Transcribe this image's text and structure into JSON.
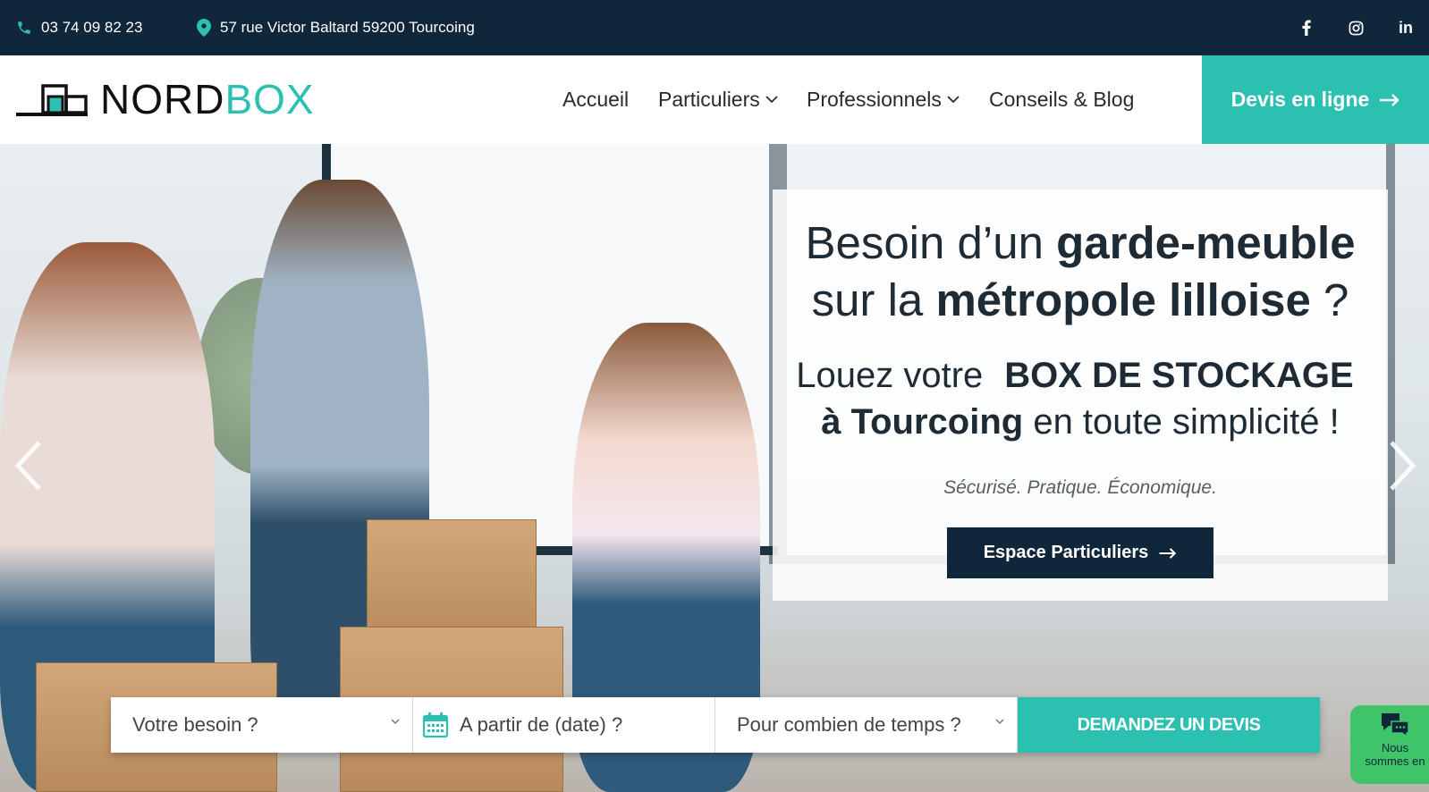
{
  "topbar": {
    "phone": "03 74 09 82 23",
    "address": "57 rue Victor Baltard 59200 Tourcoing",
    "social": [
      "facebook-icon",
      "instagram-icon",
      "linkedin-icon"
    ],
    "linkedin_label": "in"
  },
  "header": {
    "logo_part1": "NORD",
    "logo_part2": "BOX",
    "nav": {
      "accueil": "Accueil",
      "particuliers": "Particuliers",
      "professionnels": "Professionnels",
      "conseils": "Conseils & Blog"
    },
    "cta": "Devis en ligne"
  },
  "hero": {
    "title_line1_a": "Besoin d’un ",
    "title_line1_b": "garde-meuble",
    "title_line2_a": "sur la ",
    "title_line2_b": "métropole lilloise",
    "title_line2_c": " ?",
    "sub_line1_a": "Louez votre",
    "sub_line1_b": "BOX DE STOCKAGE",
    "sub_line2_a": "à Tourcoing",
    "sub_line2_b": " en toute simplicité !",
    "tagline": "Sécurisé. Pratique. Économique.",
    "button": "Espace Particuliers"
  },
  "search": {
    "need": "Votre besoin ?",
    "date": "A partir de (date) ?",
    "duration": "Pour combien de temps ?",
    "submit": "DEMANDEZ UN DEVIS"
  },
  "chat": {
    "line1": "Nous",
    "line2": "sommes en"
  },
  "colors": {
    "accent": "#2cc0b0",
    "dark": "#10263a",
    "chat": "#3fc46a"
  }
}
